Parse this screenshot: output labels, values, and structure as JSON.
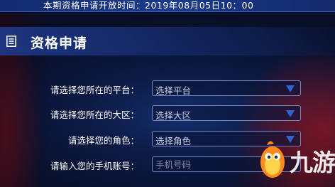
{
  "topbar": {
    "notice": "本期资格申请开放时间：2019年08月05日10：00"
  },
  "header": {
    "title": "资格申请",
    "icon": "document-list-icon"
  },
  "form": {
    "platform": {
      "label": "请选择您所在的平台：",
      "value": "选择平台"
    },
    "region": {
      "label": "请选择您所在的大区：",
      "value": "选择大区"
    },
    "role": {
      "label": "请选择您的角色：",
      "value": "选择角色"
    },
    "phone": {
      "label": "请输入您的手机账号：",
      "placeholder": "手机号码"
    }
  },
  "watermark": {
    "text": "九游",
    "icon": "mascot-logo-icon"
  },
  "colors": {
    "caret": "#2d63d4",
    "field_border": "#7486c4",
    "topbar": "#1a3a8e"
  }
}
